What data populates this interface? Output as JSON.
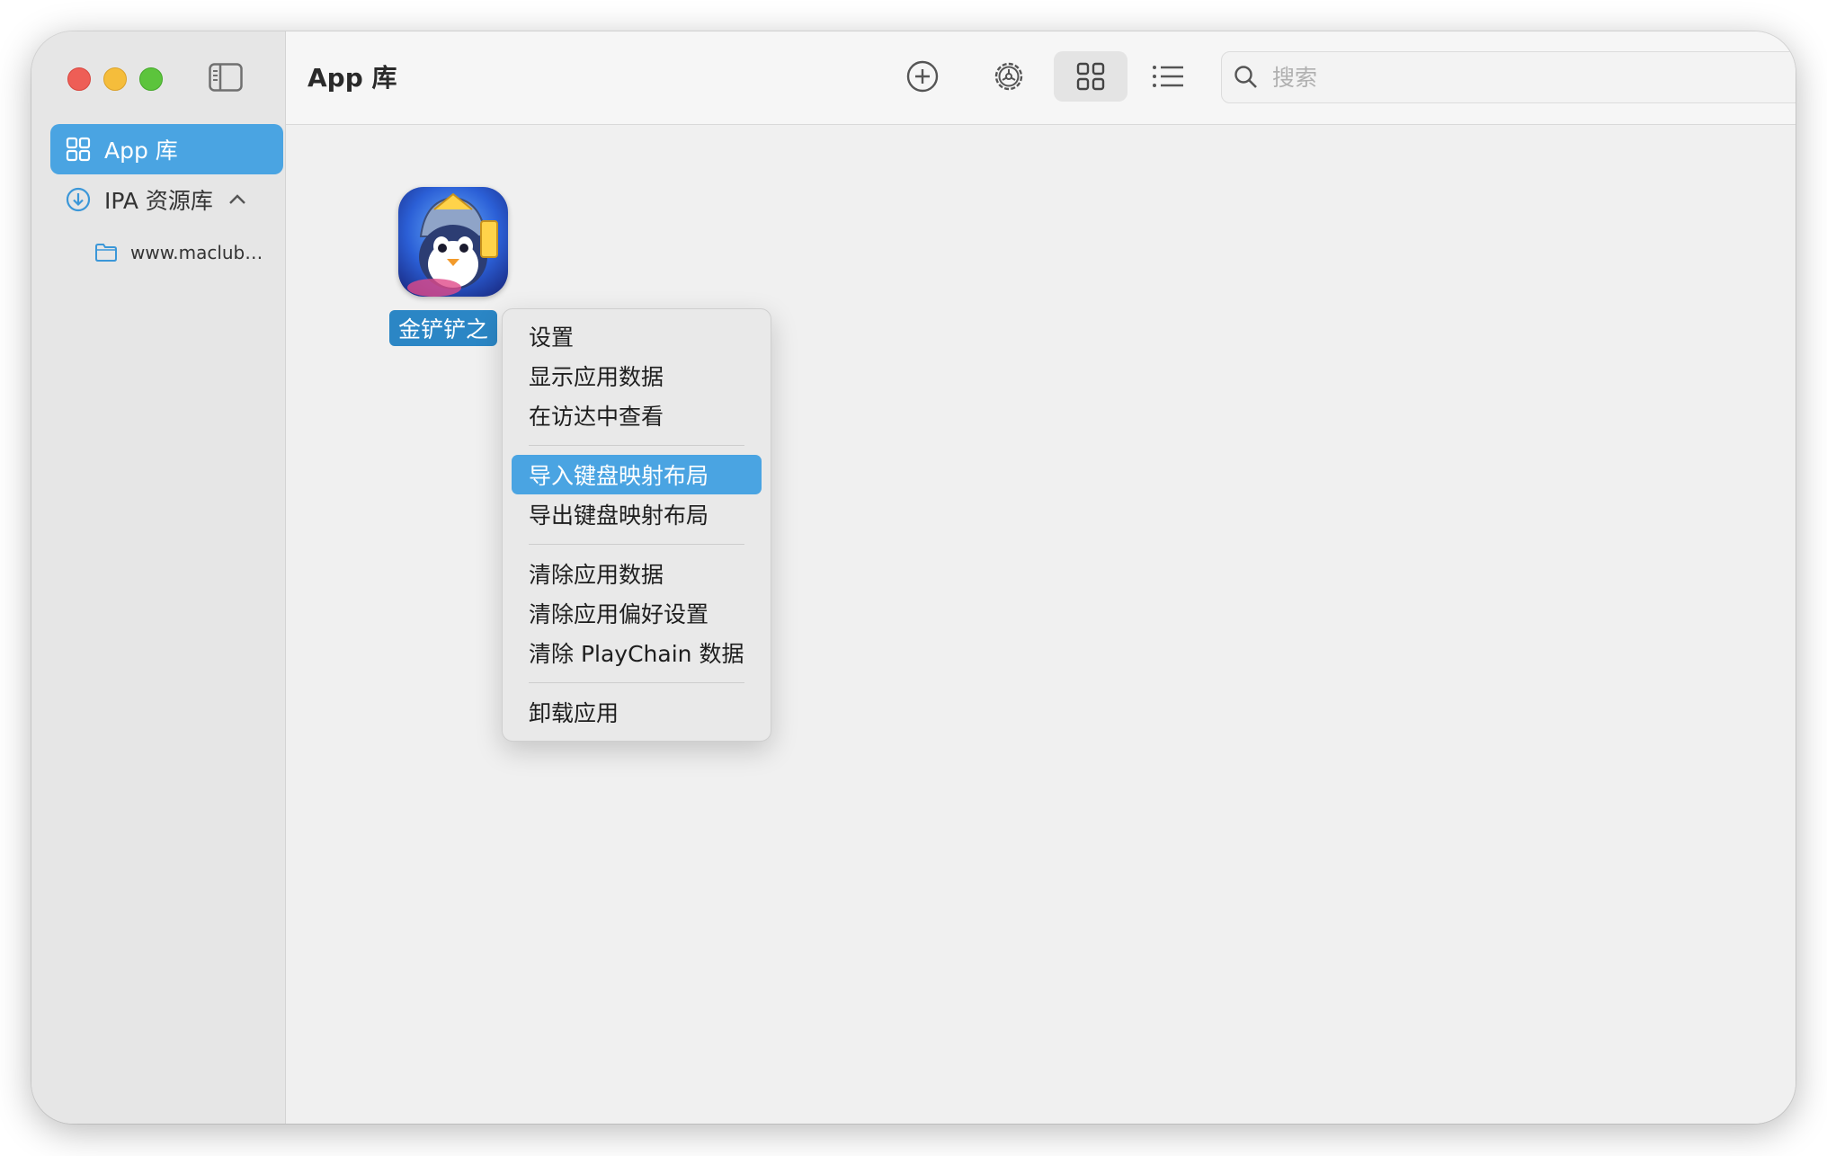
{
  "window": {
    "title": "App 库"
  },
  "sidebar": {
    "items": [
      {
        "label": "App 库",
        "icon": "grid-icon",
        "selected": true
      },
      {
        "label": "IPA 资源库",
        "icon": "download-circle-icon",
        "expanded": true
      }
    ],
    "sub_items": [
      {
        "label": "www.maclub....",
        "icon": "folder-icon"
      }
    ]
  },
  "toolbar": {
    "buttons": [
      "add-icon",
      "settings-icon",
      "grid-view-icon",
      "list-view-icon"
    ],
    "selected_view": "grid",
    "search_placeholder": "搜索",
    "search_value": ""
  },
  "apps": [
    {
      "label": "金铲铲之"
    }
  ],
  "context_menu": {
    "items": [
      {
        "label": "设置"
      },
      {
        "label": "显示应用数据"
      },
      {
        "label": "在访达中查看"
      },
      {
        "label": "导入键盘映射布局",
        "highlighted": true
      },
      {
        "label": "导出键盘映射布局"
      },
      {
        "label": "清除应用数据"
      },
      {
        "label": "清除应用偏好设置"
      },
      {
        "label": "清除 PlayChain 数据"
      },
      {
        "label": "卸载应用"
      }
    ]
  },
  "colors": {
    "accent": "#4aa4e2",
    "close": "#ee5e56",
    "minimize": "#f5bd3b",
    "maximize": "#5cc43c"
  }
}
